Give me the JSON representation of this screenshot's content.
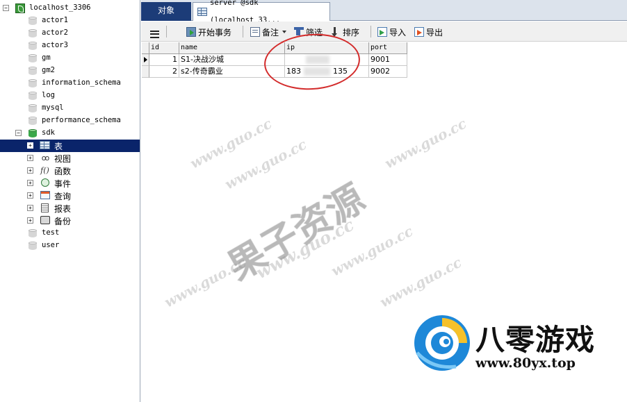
{
  "sidebar": {
    "connection": {
      "label": "localhost_3306",
      "expander": "−"
    },
    "databases_before": [
      "actor1",
      "actor2",
      "actor3",
      "gm",
      "gm2",
      "information_schema",
      "log",
      "mysql",
      "performance_schema"
    ],
    "active_db": {
      "label": "sdk",
      "expander": "−"
    },
    "object_groups": [
      {
        "label": "表",
        "icon": "table-icon",
        "expander": "+"
      },
      {
        "label": "视图",
        "icon": "view-icon",
        "expander": "+"
      },
      {
        "label": "函数",
        "icon": "function-icon",
        "expander": "+"
      },
      {
        "label": "事件",
        "icon": "event-icon",
        "expander": "+"
      },
      {
        "label": "查询",
        "icon": "query-icon",
        "expander": "+"
      },
      {
        "label": "报表",
        "icon": "report-icon",
        "expander": "+"
      },
      {
        "label": "备份",
        "icon": "backup-icon",
        "expander": "+"
      }
    ],
    "databases_after": [
      "test",
      "user"
    ]
  },
  "tabs": {
    "objects": "对象",
    "server": "server @sdk (localhost_33..."
  },
  "toolbar": {
    "begin_transaction": "开始事务",
    "note": "备注",
    "filter": "筛选",
    "sort": "排序",
    "import": "导入",
    "export": "导出"
  },
  "grid": {
    "columns": [
      "id",
      "name",
      "ip",
      "port"
    ],
    "rows": [
      {
        "id": "1",
        "name": "S1-决战沙城",
        "ip_visible": "",
        "ip_tail": "",
        "port": "9001"
      },
      {
        "id": "2",
        "name": "s2-传奇霸业",
        "ip_visible": "183",
        "ip_tail": "135",
        "port": "9002"
      }
    ]
  },
  "watermarks": {
    "url": "www.guo.cc",
    "big": "果子资源"
  },
  "brand": {
    "name": "八零游戏",
    "url": "www.80yx.top"
  },
  "colors": {
    "selection": "#0a246a",
    "active_tab": "#1c3c78",
    "annotation": "#d32b2b",
    "db_active": "#3aa84a"
  }
}
